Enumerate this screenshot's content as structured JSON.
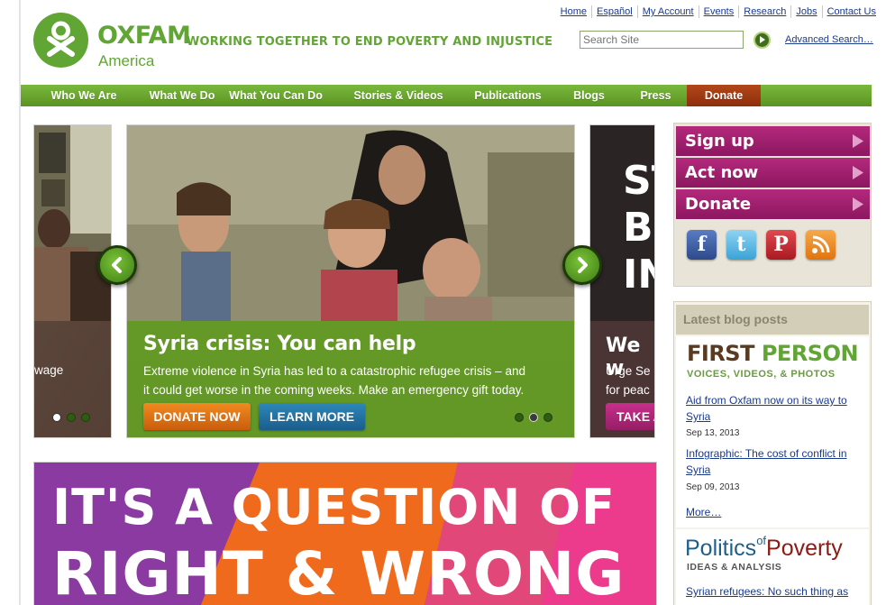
{
  "header": {
    "brand": "OXFAM",
    "brand_sub": "America",
    "tagline": "WORKING TOGETHER TO END POVERTY AND INJUSTICE",
    "utility_links": [
      "Home",
      "Español",
      "My Account",
      "Events",
      "Research",
      "Jobs",
      "Contact Us"
    ],
    "search_placeholder": "Search Site",
    "advanced_search": "Advanced Search…"
  },
  "nav": {
    "items": [
      "Who We Are",
      "What We Do",
      "What You Can Do",
      "Stories & Videos",
      "Publications",
      "Blogs",
      "Press",
      "Donate"
    ]
  },
  "carousel": {
    "main": {
      "title": "Syria crisis: You can help",
      "text_line1": "Extreme violence in Syria has led to a catastrophic refugee crisis – and",
      "text_line2": "it could get worse in the coming weeks. Make an emergency gift today.",
      "donate_label": "DONATE NOW",
      "learn_label": "LEARN MORE",
      "dots": 3,
      "active_dot": 1
    },
    "left": {
      "text": "wage",
      "active_dot": 0
    },
    "right": {
      "big_lines": [
        "ST",
        "BE",
        "IN"
      ],
      "title": "We w",
      "text_line1": "Urge Se",
      "text_line2": "for peac",
      "button": "TAKE A"
    }
  },
  "sidebar": {
    "buttons": [
      "Sign up",
      "Act now",
      "Donate"
    ],
    "social": [
      {
        "icon": "facebook-icon",
        "glyph": "f",
        "color": "#3b5ca0"
      },
      {
        "icon": "twitter-icon",
        "glyph": "t",
        "color": "#4cb3e6"
      },
      {
        "icon": "pinterest-icon",
        "glyph": "P",
        "color": "#c8232c"
      },
      {
        "icon": "rss-icon",
        "glyph": "))",
        "color": "#f28a1b"
      }
    ],
    "blog": {
      "heading": "Latest blog posts",
      "first_person_a": "FIRST ",
      "first_person_b": "PERSON",
      "first_person_sub": "VOICES, VIDEOS, & PHOTOS",
      "posts": [
        {
          "line1": "Aid from Oxfam now on its way to",
          "line2": "Syria",
          "date": "Sep 13, 2013"
        },
        {
          "line1": "Infographic: The cost of conflict in",
          "line2": "Syria",
          "date": "Sep 09, 2013"
        }
      ],
      "more": "More…",
      "pop_politics": "Politics",
      "pop_of": "of",
      "pop_poverty": "Poverty",
      "pop_sub": "IDEAS & ANALYSIS",
      "pop_post": "Syrian refugees: No such thing as"
    }
  },
  "banner": {
    "line1": "IT'S A QUESTION OF",
    "line2": "RIGHT & WRONG"
  }
}
